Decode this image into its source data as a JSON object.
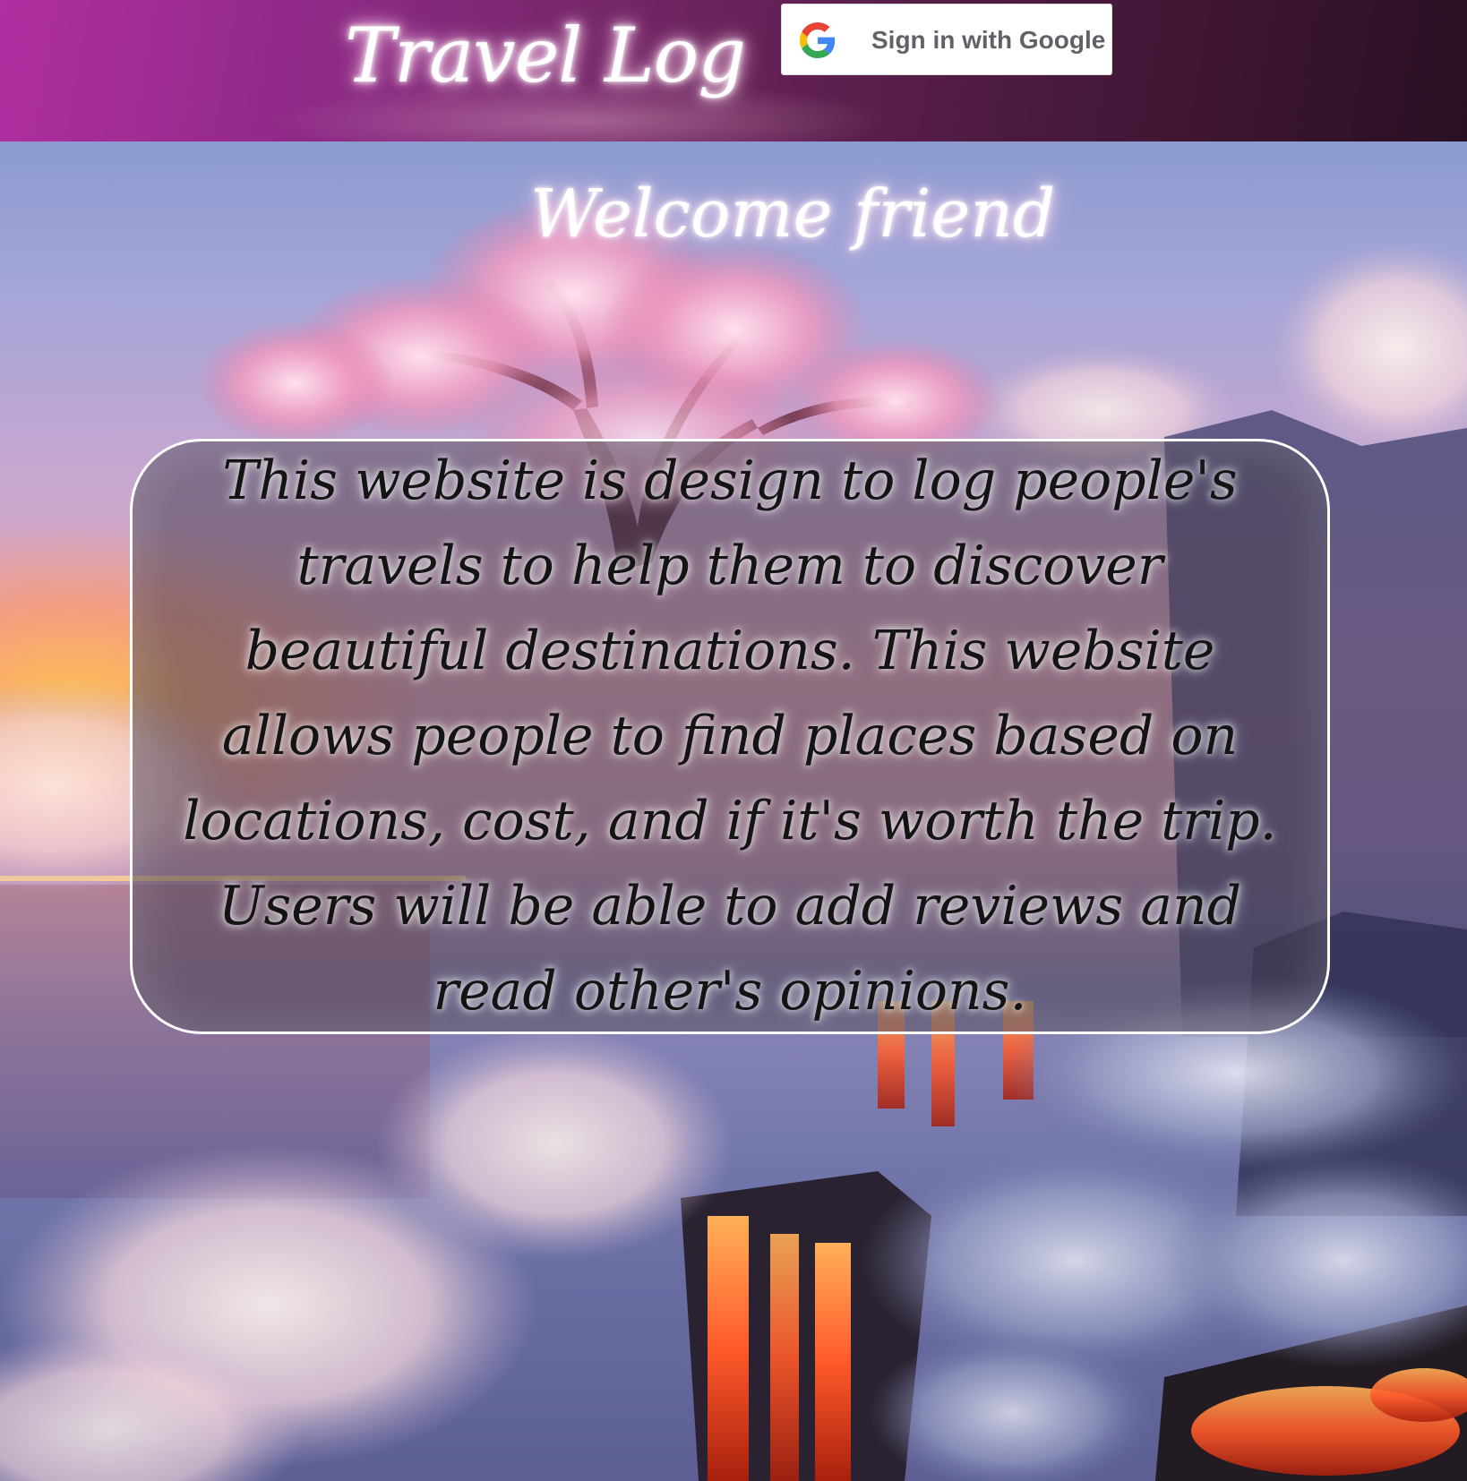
{
  "header": {
    "title": "Travel Log",
    "google_button": {
      "label": "Sign in with Google",
      "icon": "google-g-icon"
    }
  },
  "main": {
    "welcome": "Welcome friend",
    "description": "This website is design to log people's travels to help them to discover beautiful destinations. This website allows people to find places based on locations, cost, and if it's worth the trip. Users will be able to add reviews and read other's opinions."
  },
  "colors": {
    "header_start": "#b02ea0",
    "header_end": "#2a0f22",
    "google_text": "#5f6368",
    "card_border": "#ffffff",
    "text_glow": "#ffffff"
  }
}
